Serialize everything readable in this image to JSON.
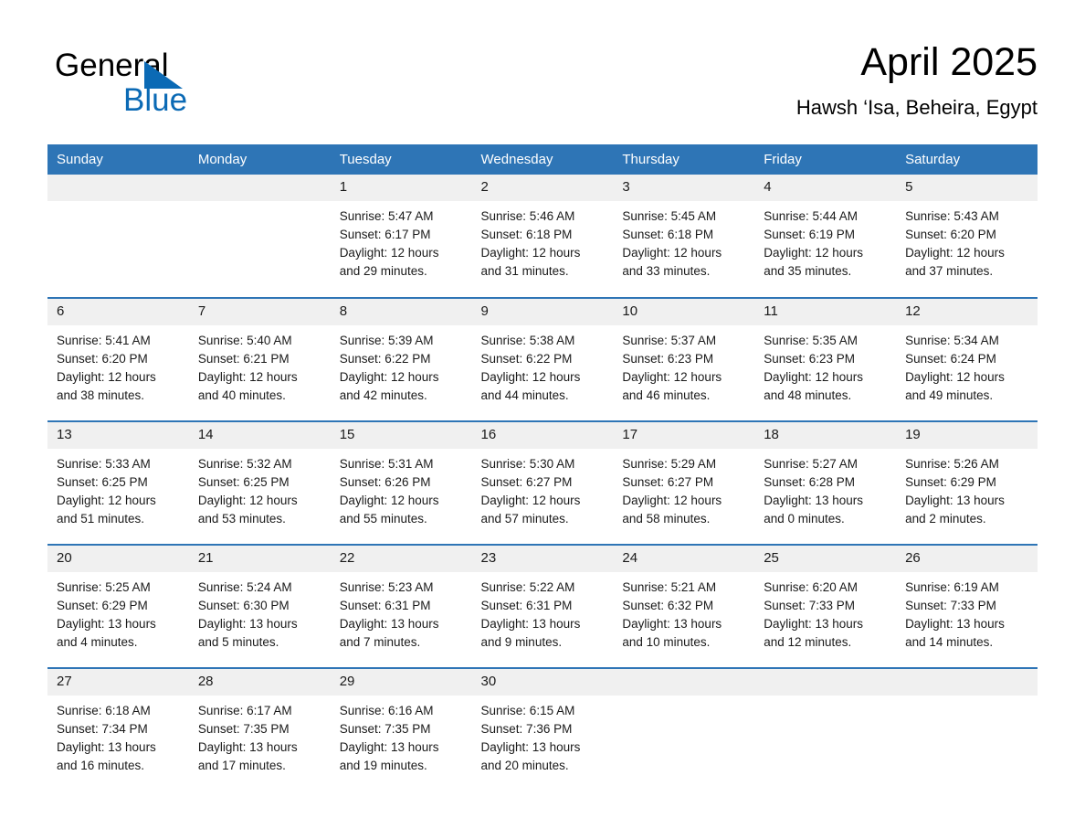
{
  "brand": {
    "name_part1": "General",
    "name_part2": "Blue",
    "accent_color": "#0b6ab5"
  },
  "header": {
    "month_title": "April 2025",
    "location": "Hawsh ‘Isa, Beheira, Egypt"
  },
  "theme": {
    "header_blue": "#2e75b6",
    "daynum_band": "#f0f0f0",
    "text_color": "#1a1a1a"
  },
  "weekday_headers": [
    "Sunday",
    "Monday",
    "Tuesday",
    "Wednesday",
    "Thursday",
    "Friday",
    "Saturday"
  ],
  "labels": {
    "sunrise_prefix": "Sunrise:",
    "sunset_prefix": "Sunset:",
    "daylight_prefix": "Daylight:"
  },
  "weeks": [
    [
      {
        "day": "",
        "empty": true
      },
      {
        "day": "",
        "empty": true
      },
      {
        "day": "1",
        "line1": "Sunrise: 5:47 AM",
        "line2": "Sunset: 6:17 PM",
        "line3": "Daylight: 12 hours",
        "line4": "and 29 minutes."
      },
      {
        "day": "2",
        "line1": "Sunrise: 5:46 AM",
        "line2": "Sunset: 6:18 PM",
        "line3": "Daylight: 12 hours",
        "line4": "and 31 minutes."
      },
      {
        "day": "3",
        "line1": "Sunrise: 5:45 AM",
        "line2": "Sunset: 6:18 PM",
        "line3": "Daylight: 12 hours",
        "line4": "and 33 minutes."
      },
      {
        "day": "4",
        "line1": "Sunrise: 5:44 AM",
        "line2": "Sunset: 6:19 PM",
        "line3": "Daylight: 12 hours",
        "line4": "and 35 minutes."
      },
      {
        "day": "5",
        "line1": "Sunrise: 5:43 AM",
        "line2": "Sunset: 6:20 PM",
        "line3": "Daylight: 12 hours",
        "line4": "and 37 minutes."
      }
    ],
    [
      {
        "day": "6",
        "line1": "Sunrise: 5:41 AM",
        "line2": "Sunset: 6:20 PM",
        "line3": "Daylight: 12 hours",
        "line4": "and 38 minutes."
      },
      {
        "day": "7",
        "line1": "Sunrise: 5:40 AM",
        "line2": "Sunset: 6:21 PM",
        "line3": "Daylight: 12 hours",
        "line4": "and 40 minutes."
      },
      {
        "day": "8",
        "line1": "Sunrise: 5:39 AM",
        "line2": "Sunset: 6:22 PM",
        "line3": "Daylight: 12 hours",
        "line4": "and 42 minutes."
      },
      {
        "day": "9",
        "line1": "Sunrise: 5:38 AM",
        "line2": "Sunset: 6:22 PM",
        "line3": "Daylight: 12 hours",
        "line4": "and 44 minutes."
      },
      {
        "day": "10",
        "line1": "Sunrise: 5:37 AM",
        "line2": "Sunset: 6:23 PM",
        "line3": "Daylight: 12 hours",
        "line4": "and 46 minutes."
      },
      {
        "day": "11",
        "line1": "Sunrise: 5:35 AM",
        "line2": "Sunset: 6:23 PM",
        "line3": "Daylight: 12 hours",
        "line4": "and 48 minutes."
      },
      {
        "day": "12",
        "line1": "Sunrise: 5:34 AM",
        "line2": "Sunset: 6:24 PM",
        "line3": "Daylight: 12 hours",
        "line4": "and 49 minutes."
      }
    ],
    [
      {
        "day": "13",
        "line1": "Sunrise: 5:33 AM",
        "line2": "Sunset: 6:25 PM",
        "line3": "Daylight: 12 hours",
        "line4": "and 51 minutes."
      },
      {
        "day": "14",
        "line1": "Sunrise: 5:32 AM",
        "line2": "Sunset: 6:25 PM",
        "line3": "Daylight: 12 hours",
        "line4": "and 53 minutes."
      },
      {
        "day": "15",
        "line1": "Sunrise: 5:31 AM",
        "line2": "Sunset: 6:26 PM",
        "line3": "Daylight: 12 hours",
        "line4": "and 55 minutes."
      },
      {
        "day": "16",
        "line1": "Sunrise: 5:30 AM",
        "line2": "Sunset: 6:27 PM",
        "line3": "Daylight: 12 hours",
        "line4": "and 57 minutes."
      },
      {
        "day": "17",
        "line1": "Sunrise: 5:29 AM",
        "line2": "Sunset: 6:27 PM",
        "line3": "Daylight: 12 hours",
        "line4": "and 58 minutes."
      },
      {
        "day": "18",
        "line1": "Sunrise: 5:27 AM",
        "line2": "Sunset: 6:28 PM",
        "line3": "Daylight: 13 hours",
        "line4": "and 0 minutes."
      },
      {
        "day": "19",
        "line1": "Sunrise: 5:26 AM",
        "line2": "Sunset: 6:29 PM",
        "line3": "Daylight: 13 hours",
        "line4": "and 2 minutes."
      }
    ],
    [
      {
        "day": "20",
        "line1": "Sunrise: 5:25 AM",
        "line2": "Sunset: 6:29 PM",
        "line3": "Daylight: 13 hours",
        "line4": "and 4 minutes."
      },
      {
        "day": "21",
        "line1": "Sunrise: 5:24 AM",
        "line2": "Sunset: 6:30 PM",
        "line3": "Daylight: 13 hours",
        "line4": "and 5 minutes."
      },
      {
        "day": "22",
        "line1": "Sunrise: 5:23 AM",
        "line2": "Sunset: 6:31 PM",
        "line3": "Daylight: 13 hours",
        "line4": "and 7 minutes."
      },
      {
        "day": "23",
        "line1": "Sunrise: 5:22 AM",
        "line2": "Sunset: 6:31 PM",
        "line3": "Daylight: 13 hours",
        "line4": "and 9 minutes."
      },
      {
        "day": "24",
        "line1": "Sunrise: 5:21 AM",
        "line2": "Sunset: 6:32 PM",
        "line3": "Daylight: 13 hours",
        "line4": "and 10 minutes."
      },
      {
        "day": "25",
        "line1": "Sunrise: 6:20 AM",
        "line2": "Sunset: 7:33 PM",
        "line3": "Daylight: 13 hours",
        "line4": "and 12 minutes."
      },
      {
        "day": "26",
        "line1": "Sunrise: 6:19 AM",
        "line2": "Sunset: 7:33 PM",
        "line3": "Daylight: 13 hours",
        "line4": "and 14 minutes."
      }
    ],
    [
      {
        "day": "27",
        "line1": "Sunrise: 6:18 AM",
        "line2": "Sunset: 7:34 PM",
        "line3": "Daylight: 13 hours",
        "line4": "and 16 minutes."
      },
      {
        "day": "28",
        "line1": "Sunrise: 6:17 AM",
        "line2": "Sunset: 7:35 PM",
        "line3": "Daylight: 13 hours",
        "line4": "and 17 minutes."
      },
      {
        "day": "29",
        "line1": "Sunrise: 6:16 AM",
        "line2": "Sunset: 7:35 PM",
        "line3": "Daylight: 13 hours",
        "line4": "and 19 minutes."
      },
      {
        "day": "30",
        "line1": "Sunrise: 6:15 AM",
        "line2": "Sunset: 7:36 PM",
        "line3": "Daylight: 13 hours",
        "line4": "and 20 minutes."
      },
      {
        "day": "",
        "empty": true
      },
      {
        "day": "",
        "empty": true
      },
      {
        "day": "",
        "empty": true
      }
    ]
  ]
}
